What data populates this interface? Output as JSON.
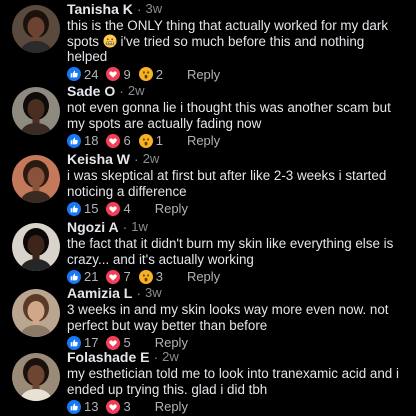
{
  "colors": {
    "background": "#000000",
    "name": "#e4e6eb",
    "text": "#e4e6eb",
    "muted": "#8a8d91",
    "like": "#1877f2",
    "love": "#f33e58",
    "wow": "#f7b125"
  },
  "comments": [
    {
      "author": "Tanisha K",
      "time": "3w",
      "text_parts": [
        "this is the ONLY thing that actually worked for my dark spots",
        "i've tried so much before this and nothing helped"
      ],
      "inline_emoji": "grimacing-face-icon",
      "likes": "24",
      "loves": "9",
      "wows": "2",
      "reply": "Reply",
      "avatar": {
        "skin": "#6b4330",
        "hair": "#1b120d",
        "bg": "#5a4a3e",
        "shirt": "#2b2b2b"
      }
    },
    {
      "author": "Sade O",
      "time": "2w",
      "text_parts": [
        "not even gonna lie i thought this was another scam but my spots are actually fading now"
      ],
      "likes": "18",
      "loves": "6",
      "wows": "1",
      "reply": "Reply",
      "avatar": {
        "skin": "#4a2e22",
        "hair": "#0e0b09",
        "bg": "#8f8a7f",
        "shirt": "#3a2c24"
      }
    },
    {
      "author": "Keisha W",
      "time": "2w",
      "text_parts": [
        "i was skeptical at first but after like 2-3 weeks i started noticing a difference"
      ],
      "likes": "15",
      "loves": "4",
      "reply": "Reply",
      "avatar": {
        "skin": "#8a5238",
        "hair": "#2a1a12",
        "bg": "#c47a5a",
        "shirt": "#3b2a22"
      }
    },
    {
      "author": "Ngozi A",
      "time": "1w",
      "text_parts": [
        "the fact that it didn't burn my skin like everything else is crazy... and it's actually working"
      ],
      "likes": "21",
      "loves": "7",
      "wows": "3",
      "reply": "Reply",
      "avatar": {
        "skin": "#3e2519",
        "hair": "#0b0907",
        "bg": "#d8d4cc",
        "shirt": "#262626"
      }
    },
    {
      "author": "Aamizia L",
      "time": "3w",
      "text_parts": [
        "3 weeks in and my skin looks way more even now. not perfect but way better than before"
      ],
      "likes": "17",
      "loves": "5",
      "reply": "Reply",
      "avatar": {
        "skin": "#d1a78a",
        "hair": "#5a3a26",
        "bg": "#b9a590",
        "shirt": "#8c7a68"
      }
    },
    {
      "author": "Folashade E",
      "time": "2w",
      "text_parts": [
        "my esthetician told me to look into tranexamic acid and i ended up trying this. glad i did tbh"
      ],
      "likes": "13",
      "loves": "3",
      "reply": "Reply",
      "avatar": {
        "skin": "#6e4530",
        "hair": "#1a110c",
        "bg": "#9a8a78",
        "shirt": "#e8e2d6"
      }
    }
  ]
}
